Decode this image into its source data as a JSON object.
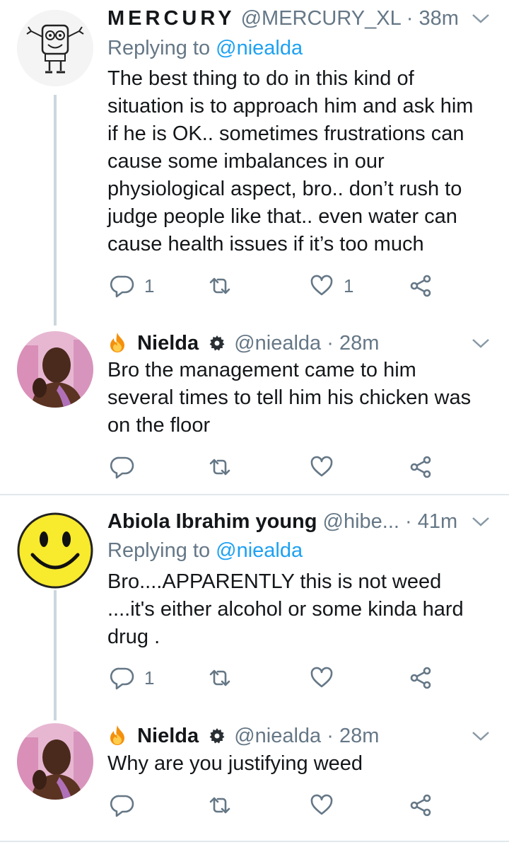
{
  "tweets": [
    {
      "name": "MERCURY",
      "handle": "@MERCURY_XL",
      "time": "38m",
      "replying_label": "Replying to",
      "replying_to": "@niealda",
      "text": "The best thing to do in this kind of situation is to approach him and ask him if he is OK.. sometimes frustrations can cause some imbalances in our physiological aspect, bro.. don’t rush to judge people like that.. even water can cause health issues if it’s too much",
      "reply_count": "1",
      "retweet_count": "",
      "like_count": "1",
      "avatar_icon": "spongebob-icon"
    },
    {
      "name": "Nielda",
      "handle": "@niealda",
      "time": "28m",
      "text": "Bro the management came to him several times to tell him his chicken was on the floor",
      "reply_count": "",
      "retweet_count": "",
      "like_count": "",
      "avatar_icon": "profile-photo"
    },
    {
      "name": "Abiola Ibrahim young",
      "handle": "@hibe...",
      "time": "41m",
      "replying_label": "Replying to",
      "replying_to": "@niealda",
      "text": "Bro....APPARENTLY this is not weed ....it's either alcohol or some kinda hard drug .",
      "reply_count": "1",
      "retweet_count": "",
      "like_count": "",
      "avatar_icon": "smiley-icon"
    },
    {
      "name": "Nielda",
      "handle": "@niealda",
      "time": "28m",
      "text": "Why are you justifying weed",
      "reply_count": "",
      "retweet_count": "",
      "like_count": "",
      "avatar_icon": "profile-photo"
    }
  ],
  "separator": "·",
  "colors": {
    "accent": "#1da1f2",
    "secondary_text": "#657786",
    "thread_line": "#ccd6dd",
    "divider": "#e1e8ed"
  }
}
